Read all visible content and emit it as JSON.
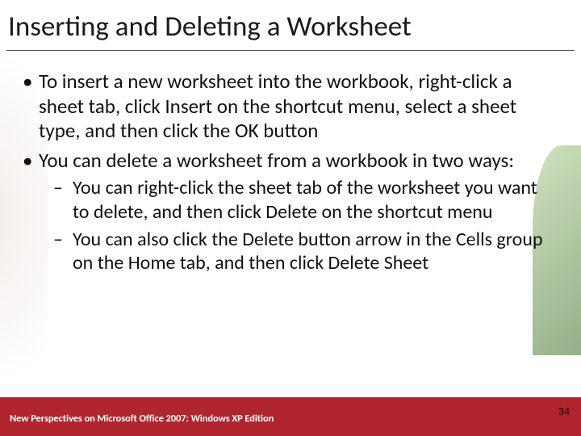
{
  "heading": "Inserting and Deleting a Worksheet",
  "bullets": [
    {
      "text": "To insert a new worksheet into the workbook, right-click a sheet tab, click Insert on the shortcut menu, select a sheet type, and then click the OK button",
      "children": []
    },
    {
      "text": "You can delete a worksheet from a workbook in two ways:",
      "children": [
        "You can right-click the sheet tab of the worksheet you want to delete, and then click Delete on the shortcut menu",
        "You can also click the Delete button arrow in the Cells group on the Home tab, and then click Delete Sheet"
      ]
    }
  ],
  "footer": "New Perspectives on Microsoft Office 2007: Windows XP Edition",
  "page_number": "34",
  "colors": {
    "footer_bg": "#b0252e",
    "text": "#111111"
  }
}
